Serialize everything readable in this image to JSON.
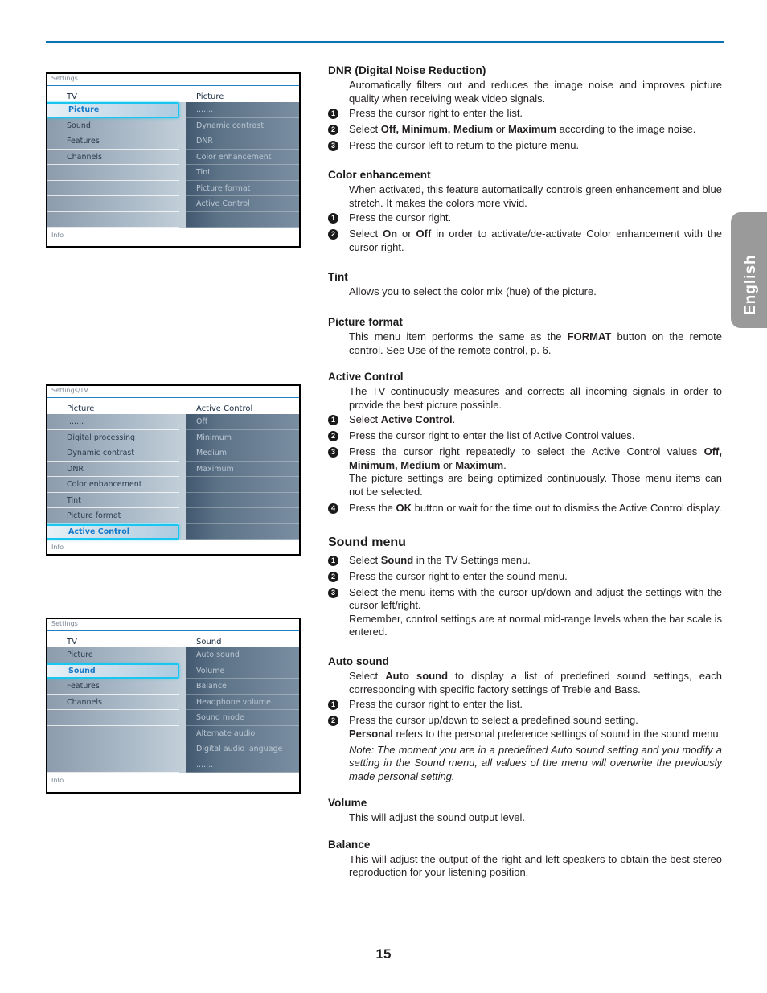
{
  "page": {
    "number": "15",
    "language_tab": "English",
    "accent_rule_color": "#0a72b5"
  },
  "osd_screens": [
    {
      "name": "picture-menu",
      "titlebar": "Settings",
      "footer": "Info",
      "left_header": "TV",
      "right_header": "Picture",
      "left_items": [
        {
          "label": "Picture",
          "selected": true
        },
        {
          "label": "Sound",
          "selected": false
        },
        {
          "label": "Features",
          "selected": false
        },
        {
          "label": "Channels",
          "selected": false
        },
        {
          "label": "",
          "selected": false
        },
        {
          "label": "",
          "selected": false
        },
        {
          "label": "",
          "selected": false
        },
        {
          "label": "",
          "selected": false
        }
      ],
      "right_items": [
        {
          "label": "......."
        },
        {
          "label": "Dynamic contrast"
        },
        {
          "label": "DNR"
        },
        {
          "label": "Color enhancement"
        },
        {
          "label": "Tint"
        },
        {
          "label": "Picture format"
        },
        {
          "label": "Active Control"
        },
        {
          "label": ""
        }
      ]
    },
    {
      "name": "active-control-menu",
      "titlebar": "Settings/TV",
      "footer": "Info",
      "left_header": "Picture",
      "right_header": "Active Control",
      "left_items": [
        {
          "label": ".......",
          "selected": false
        },
        {
          "label": "Digital processing",
          "selected": false
        },
        {
          "label": "Dynamic contrast",
          "selected": false
        },
        {
          "label": "DNR",
          "selected": false
        },
        {
          "label": "Color enhancement",
          "selected": false
        },
        {
          "label": "Tint",
          "selected": false
        },
        {
          "label": "Picture format",
          "selected": false
        },
        {
          "label": "Active Control",
          "selected": true
        }
      ],
      "right_items": [
        {
          "label": "Off"
        },
        {
          "label": "Minimum"
        },
        {
          "label": "Medium"
        },
        {
          "label": "Maximum"
        },
        {
          "label": ""
        },
        {
          "label": ""
        },
        {
          "label": ""
        },
        {
          "label": ""
        }
      ]
    },
    {
      "name": "sound-menu",
      "titlebar": "Settings",
      "footer": "Info",
      "left_header": "TV",
      "right_header": "Sound",
      "left_items": [
        {
          "label": "Picture",
          "selected": false
        },
        {
          "label": "Sound",
          "selected": true
        },
        {
          "label": "Features",
          "selected": false
        },
        {
          "label": "Channels",
          "selected": false
        },
        {
          "label": "",
          "selected": false
        },
        {
          "label": "",
          "selected": false
        },
        {
          "label": "",
          "selected": false
        },
        {
          "label": "",
          "selected": false
        }
      ],
      "right_items": [
        {
          "label": "Auto sound"
        },
        {
          "label": "Volume"
        },
        {
          "label": "Balance"
        },
        {
          "label": "Headphone volume"
        },
        {
          "label": "Sound mode"
        },
        {
          "label": "Alternate audio"
        },
        {
          "label": "Digital audio language"
        },
        {
          "label": "......."
        }
      ]
    }
  ],
  "content": {
    "dnr": {
      "heading_bold": "DNR",
      "heading_rest": " (Digital Noise Reduction)",
      "body": "Automatically filters out and reduces the image noise and improves picture quality when receiving weak video signals.",
      "steps": [
        "Press the cursor right to enter the list.",
        "Select Off, Minimum, Medium or Maximum according to the image noise.",
        "Press the cursor left to return to the picture menu."
      ]
    },
    "color_enhancement": {
      "heading": "Color enhancement",
      "body": "When activated, this feature automatically controls green enhancement and blue stretch. It makes the colors more vivid.",
      "steps": [
        "Press the cursor right.",
        "Select On or Off in order to activate/de-activate Color enhancement with the cursor right."
      ]
    },
    "tint": {
      "heading": "Tint",
      "body": "Allows you to select the color mix (hue) of the picture."
    },
    "picture_format": {
      "heading": "Picture format",
      "body": "This menu item performs the same as the FORMAT button on the remote control. See Use of the remote control, p. 6."
    },
    "active_control": {
      "heading": "Active Control",
      "body": "The TV continuously measures and corrects all incoming signals in order to provide the best picture possible.",
      "steps": [
        "Select Active Control.",
        "Press the cursor right to enter the list of Active Control values.",
        "Press the cursor right repeatedly to select the Active Control values Off, Minimum, Medium or Maximum. The picture settings are being optimized continuously. Those menu items can not be selected.",
        "Press the OK button or wait for the time out to dismiss the Active Control display."
      ]
    },
    "sound_menu": {
      "heading": "Sound menu",
      "steps": [
        "Select Sound in the TV Settings menu.",
        "Press the cursor right to enter the sound menu.",
        "Select the menu items with the cursor up/down and adjust the settings with the cursor left/right. Remember, control settings are at normal mid-range levels when the bar scale is entered."
      ]
    },
    "auto_sound": {
      "heading": "Auto sound",
      "body": "Select Auto sound to display a list of predefined sound settings, each corresponding with specific factory settings of Treble and Bass.",
      "steps": [
        "Press the cursor right to enter the list.",
        "Press the cursor up/down to select a predefined sound setting. Personal refers to the personal preference settings of sound in the sound menu."
      ],
      "note": "Note: The moment you are in a predefined Auto sound setting and you modify a setting in the Sound menu, all values of the menu will overwrite the previously made personal setting."
    },
    "volume": {
      "heading": "Volume",
      "body": "This will adjust the sound output level."
    },
    "balance": {
      "heading": "Balance",
      "body": "This will adjust the output of the right and left speakers to obtain the best stereo reproduction for your listening position."
    }
  }
}
